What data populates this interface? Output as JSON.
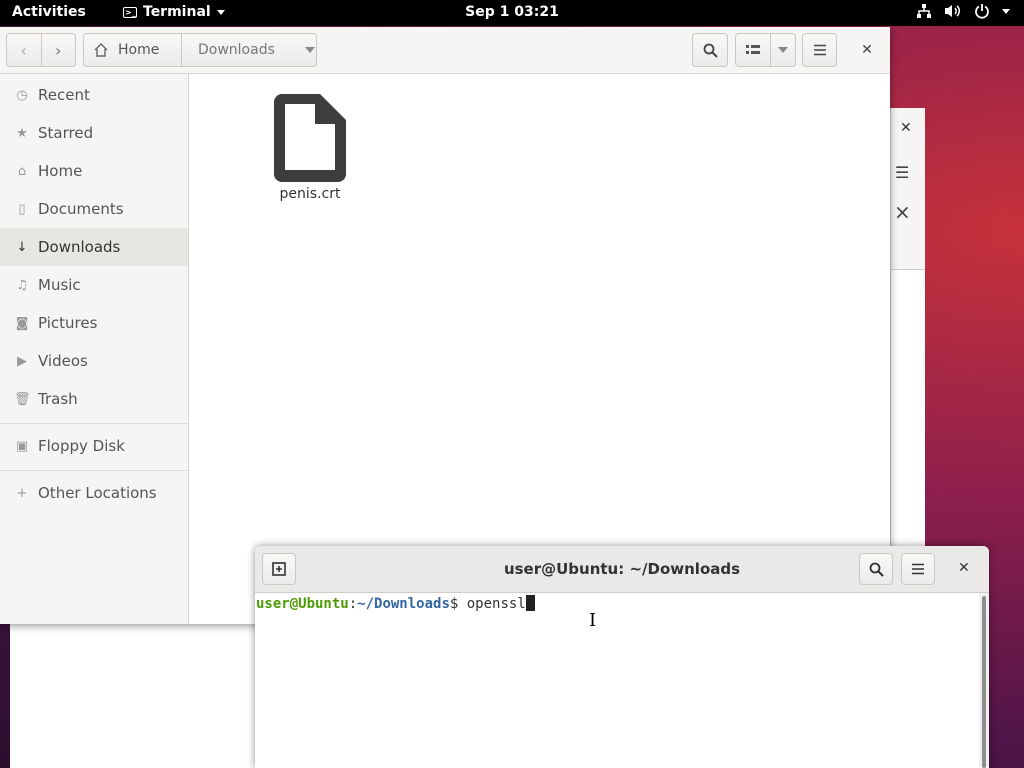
{
  "topbar": {
    "activities": "Activities",
    "app_name": "Terminal",
    "clock": "Sep 1  03:21"
  },
  "files": {
    "path": {
      "home": "Home",
      "current": "Downloads"
    },
    "sidebar": [
      {
        "label": "Recent",
        "icon": "clock-icon"
      },
      {
        "label": "Starred",
        "icon": "star-icon"
      },
      {
        "label": "Home",
        "icon": "home-icon"
      },
      {
        "label": "Documents",
        "icon": "document-icon"
      },
      {
        "label": "Downloads",
        "icon": "download-icon",
        "active": true
      },
      {
        "label": "Music",
        "icon": "music-icon"
      },
      {
        "label": "Pictures",
        "icon": "camera-icon"
      },
      {
        "label": "Videos",
        "icon": "video-icon"
      },
      {
        "label": "Trash",
        "icon": "trash-icon"
      },
      {
        "label": "Floppy Disk",
        "icon": "floppy-icon"
      },
      {
        "label": "Other Locations",
        "icon": "plus-icon"
      }
    ],
    "items": [
      {
        "name": "penis.crt",
        "icon": "file-icon"
      }
    ]
  },
  "terminal": {
    "title": "user@Ubuntu: ~/Downloads",
    "prompt_user": "user@Ubuntu",
    "prompt_sep": ":",
    "prompt_path": "~/Downloads",
    "prompt_sym": "$ ",
    "command": "openssl"
  }
}
